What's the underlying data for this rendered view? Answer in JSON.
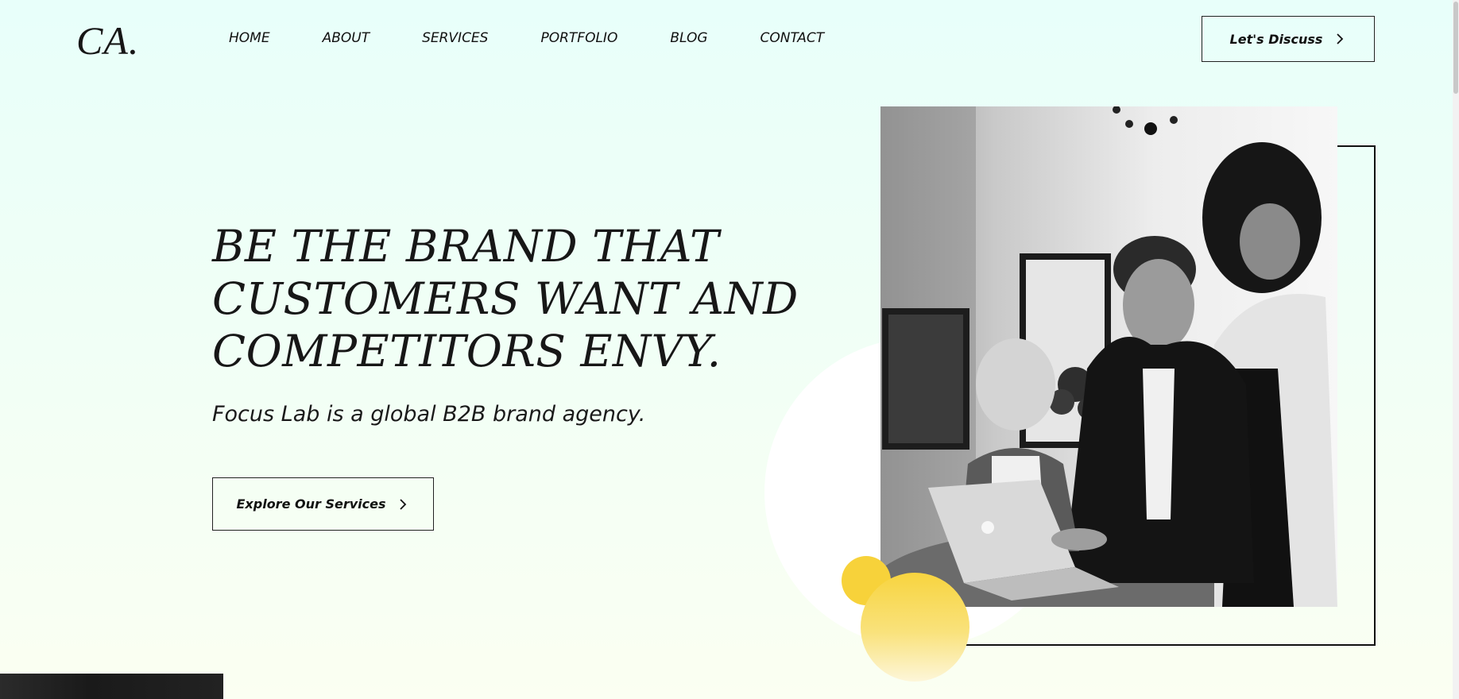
{
  "brand": {
    "logo": "CA."
  },
  "nav": {
    "items": [
      {
        "label": "HOME"
      },
      {
        "label": "ABOUT"
      },
      {
        "label": "SERVICES"
      },
      {
        "label": "PORTFOLIO"
      },
      {
        "label": "BLOG"
      },
      {
        "label": "CONTACT"
      }
    ]
  },
  "header": {
    "cta_label": "Let's Discuss",
    "cta_icon": "chevron-right-icon"
  },
  "hero": {
    "title_lines": [
      "BE THE BRAND THAT",
      "CUSTOMERS WANT AND",
      "COMPETITORS ENVY."
    ],
    "subtitle": "Focus Lab is a global B2B brand agency.",
    "cta_label": "Explore Our Services",
    "cta_icon": "chevron-right-icon"
  },
  "colors": {
    "background_top": "#e8fffa",
    "background_bottom": "#fbfff2",
    "accent_yellow": "#f7d23a",
    "text": "#111111"
  }
}
